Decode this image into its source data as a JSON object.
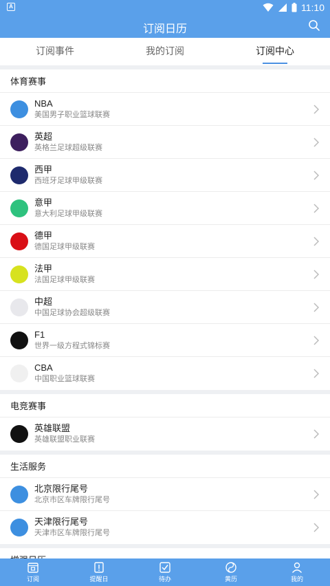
{
  "statusbar": {
    "time": "11:10"
  },
  "appbar": {
    "title": "订阅日历"
  },
  "tabs": [
    {
      "label": "订阅事件",
      "active": false
    },
    {
      "label": "我的订阅",
      "active": false
    },
    {
      "label": "订阅中心",
      "active": true
    }
  ],
  "sections": [
    {
      "title": "体育赛事",
      "items": [
        {
          "name": "NBA",
          "sub": "美国男子职业篮球联赛",
          "icon": "nba-logo-icon",
          "color": "#3d8fe0"
        },
        {
          "name": "英超",
          "sub": "英格兰足球超级联赛",
          "icon": "premier-league-logo-icon",
          "color": "#3d1f5e"
        },
        {
          "name": "西甲",
          "sub": "西班牙足球甲级联赛",
          "icon": "laliga-logo-icon",
          "color": "#1e2a6d"
        },
        {
          "name": "意甲",
          "sub": "意大利足球甲级联赛",
          "icon": "serie-a-logo-icon",
          "color": "#2ec27e"
        },
        {
          "name": "德甲",
          "sub": "德国足球甲级联赛",
          "icon": "bundesliga-logo-icon",
          "color": "#d90f16"
        },
        {
          "name": "法甲",
          "sub": "法国足球甲级联赛",
          "icon": "ligue1-logo-icon",
          "color": "#d7e21f"
        },
        {
          "name": "中超",
          "sub": "中国足球协会超级联赛",
          "icon": "csl-logo-icon",
          "color": "#e8e8ec"
        },
        {
          "name": "F1",
          "sub": "世界一级方程式锦标赛",
          "icon": "f1-logo-icon",
          "color": "#111111"
        },
        {
          "name": "CBA",
          "sub": "中国职业篮球联赛",
          "icon": "cba-logo-icon",
          "color": "#f0f0f0"
        }
      ]
    },
    {
      "title": "电竞赛事",
      "items": [
        {
          "name": "英雄联盟",
          "sub": "英雄联盟职业联赛",
          "icon": "lpl-logo-icon",
          "color": "#111111"
        }
      ]
    },
    {
      "title": "生活服务",
      "items": [
        {
          "name": "北京限行尾号",
          "sub": "北京市区车牌限行尾号",
          "icon": "beijing-plate-icon",
          "color": "#3d8fe0"
        },
        {
          "name": "天津限行尾号",
          "sub": "天津市区车牌限行尾号",
          "icon": "tianjin-plate-icon",
          "color": "#3d8fe0"
        }
      ]
    },
    {
      "title": "增强日历",
      "items": []
    }
  ],
  "bottom_nav": [
    {
      "label": "订阅",
      "icon": "calendar-icon"
    },
    {
      "label": "提醒日",
      "icon": "reminder-icon"
    },
    {
      "label": "待办",
      "icon": "todo-check-icon"
    },
    {
      "label": "黄历",
      "icon": "almanac-icon"
    },
    {
      "label": "我的",
      "icon": "profile-icon"
    }
  ],
  "colors": {
    "primary": "#5aa0ea",
    "tab_underline": "#4a90e2"
  }
}
